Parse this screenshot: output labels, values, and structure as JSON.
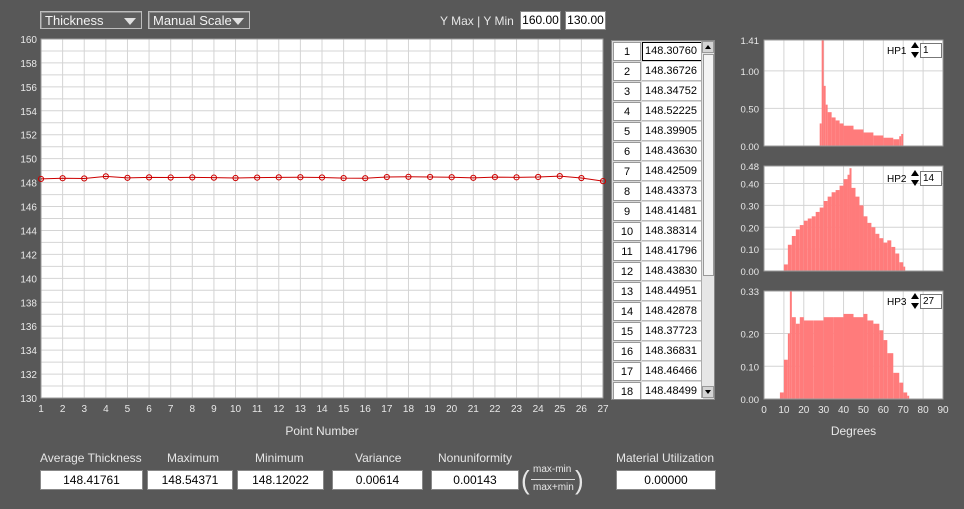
{
  "toolbar": {
    "measure_select": "Thickness",
    "scale_select": "Manual Scale",
    "ymax_ymin_label": "Y Max | Y Min",
    "ymax": "160.00",
    "ymin": "130.00"
  },
  "main_chart": {
    "x_label": "Point Number",
    "y_ticks": [
      "160",
      "158",
      "156",
      "154",
      "152",
      "150",
      "148",
      "146",
      "144",
      "142",
      "140",
      "138",
      "136",
      "134",
      "132",
      "130"
    ],
    "x_ticks": [
      "1",
      "2",
      "3",
      "4",
      "5",
      "6",
      "7",
      "8",
      "9",
      "10",
      "11",
      "12",
      "13",
      "14",
      "15",
      "16",
      "17",
      "18",
      "19",
      "20",
      "21",
      "22",
      "23",
      "24",
      "25",
      "26",
      "27"
    ]
  },
  "chart_data": [
    {
      "type": "line",
      "xlabel": "Point Number",
      "ylabel": "",
      "ylim": [
        130,
        160
      ],
      "xlim": [
        1,
        27
      ],
      "grid": true,
      "x": [
        1,
        2,
        3,
        4,
        5,
        6,
        7,
        8,
        9,
        10,
        11,
        12,
        13,
        14,
        15,
        16,
        17,
        18,
        19,
        20,
        21,
        22,
        23,
        24,
        25,
        26,
        27
      ],
      "values": [
        148.3076,
        148.36726,
        148.34752,
        148.52225,
        148.39905,
        148.4363,
        148.42509,
        148.43373,
        148.41481,
        148.38314,
        148.41796,
        148.4383,
        148.44951,
        148.42878,
        148.37723,
        148.36831,
        148.46466,
        148.48499,
        148.47,
        148.45,
        148.4,
        148.46,
        148.44,
        148.47,
        148.54371,
        148.38,
        148.12022
      ],
      "color": "#cc0000"
    },
    {
      "type": "bar",
      "label": "HP1",
      "xlabel": "Degrees",
      "xlim": [
        0,
        90
      ],
      "ylim": [
        0,
        1.41
      ],
      "y_ticks": [
        "1.41",
        "1.00",
        "0.50",
        "0.00"
      ],
      "x": [
        28,
        29,
        30,
        31,
        32,
        34,
        36,
        38,
        40,
        45,
        50,
        55,
        60,
        65,
        68,
        69
      ],
      "values": [
        0.3,
        1.41,
        0.8,
        0.55,
        0.45,
        0.38,
        0.34,
        0.3,
        0.27,
        0.22,
        0.18,
        0.14,
        0.11,
        0.09,
        0.13,
        0.16
      ],
      "color": "#ff7b7b"
    },
    {
      "type": "bar",
      "label": "HP2",
      "xlabel": "Degrees",
      "xlim": [
        0,
        90
      ],
      "ylim": [
        0,
        0.48
      ],
      "y_ticks": [
        "0.48",
        "0.40",
        "0.30",
        "0.20",
        "0.10",
        "0.00"
      ],
      "x": [
        10,
        12,
        14,
        16,
        18,
        20,
        22,
        24,
        26,
        28,
        30,
        32,
        34,
        36,
        38,
        40,
        42,
        43,
        44,
        46,
        48,
        50,
        52,
        54,
        56,
        58,
        60,
        62,
        64,
        66,
        68,
        70
      ],
      "values": [
        0.03,
        0.12,
        0.16,
        0.19,
        0.21,
        0.23,
        0.24,
        0.25,
        0.27,
        0.29,
        0.32,
        0.34,
        0.36,
        0.37,
        0.39,
        0.42,
        0.44,
        0.47,
        0.38,
        0.34,
        0.3,
        0.25,
        0.22,
        0.2,
        0.17,
        0.15,
        0.13,
        0.14,
        0.11,
        0.08,
        0.04,
        0.02
      ],
      "color": "#ff7b7b"
    },
    {
      "type": "bar",
      "label": "HP3",
      "xlabel": "Degrees",
      "xlim": [
        0,
        90
      ],
      "ylim": [
        0,
        0.33
      ],
      "y_ticks": [
        "0.33",
        "0.20",
        "0.10",
        "0.00"
      ],
      "x": [
        8,
        10,
        12,
        13,
        14,
        16,
        18,
        20,
        25,
        30,
        35,
        40,
        45,
        50,
        52,
        55,
        58,
        60,
        62,
        65,
        68,
        70,
        72
      ],
      "values": [
        0.02,
        0.12,
        0.2,
        0.33,
        0.25,
        0.23,
        0.25,
        0.24,
        0.24,
        0.25,
        0.25,
        0.26,
        0.25,
        0.26,
        0.24,
        0.23,
        0.21,
        0.18,
        0.14,
        0.08,
        0.05,
        0.02,
        0.01
      ],
      "color": "#ff7b7b"
    }
  ],
  "table": {
    "rows": [
      {
        "idx": "1",
        "val": "148.30760"
      },
      {
        "idx": "2",
        "val": "148.36726"
      },
      {
        "idx": "3",
        "val": "148.34752"
      },
      {
        "idx": "4",
        "val": "148.52225"
      },
      {
        "idx": "5",
        "val": "148.39905"
      },
      {
        "idx": "6",
        "val": "148.43630"
      },
      {
        "idx": "7",
        "val": "148.42509"
      },
      {
        "idx": "8",
        "val": "148.43373"
      },
      {
        "idx": "9",
        "val": "148.41481"
      },
      {
        "idx": "10",
        "val": "148.38314"
      },
      {
        "idx": "11",
        "val": "148.41796"
      },
      {
        "idx": "12",
        "val": "148.43830"
      },
      {
        "idx": "13",
        "val": "148.44951"
      },
      {
        "idx": "14",
        "val": "148.42878"
      },
      {
        "idx": "15",
        "val": "148.37723"
      },
      {
        "idx": "16",
        "val": "148.36831"
      },
      {
        "idx": "17",
        "val": "148.46466"
      },
      {
        "idx": "18",
        "val": "148.48499"
      }
    ]
  },
  "histograms": {
    "x_label": "Degrees",
    "x_ticks": [
      "0",
      "10",
      "20",
      "30",
      "40",
      "50",
      "60",
      "70",
      "80",
      "90"
    ],
    "hp1": {
      "label": "HP1",
      "value": "1",
      "y_ticks": [
        "1.41",
        "1.00",
        "0.50",
        "0.00"
      ]
    },
    "hp2": {
      "label": "HP2",
      "value": "14",
      "y_ticks": [
        "0.48",
        "0.40",
        "0.30",
        "0.20",
        "0.10",
        "0.00"
      ]
    },
    "hp3": {
      "label": "HP3",
      "value": "27",
      "y_ticks": [
        "0.33",
        "0.20",
        "0.10",
        "0.00"
      ]
    }
  },
  "stats": {
    "avg_label": "Average Thickness",
    "avg": "148.41761",
    "max_label": "Maximum",
    "max": "148.54371",
    "min_label": "Minimum",
    "min": "148.12022",
    "var_label": "Variance",
    "var": "0.00614",
    "nonu_label": "Nonuniformity",
    "nonu": "0.00143",
    "formula_num": "max-min",
    "formula_den": "max+min",
    "mu_label": "Material Utilization",
    "mu": "0.00000"
  }
}
